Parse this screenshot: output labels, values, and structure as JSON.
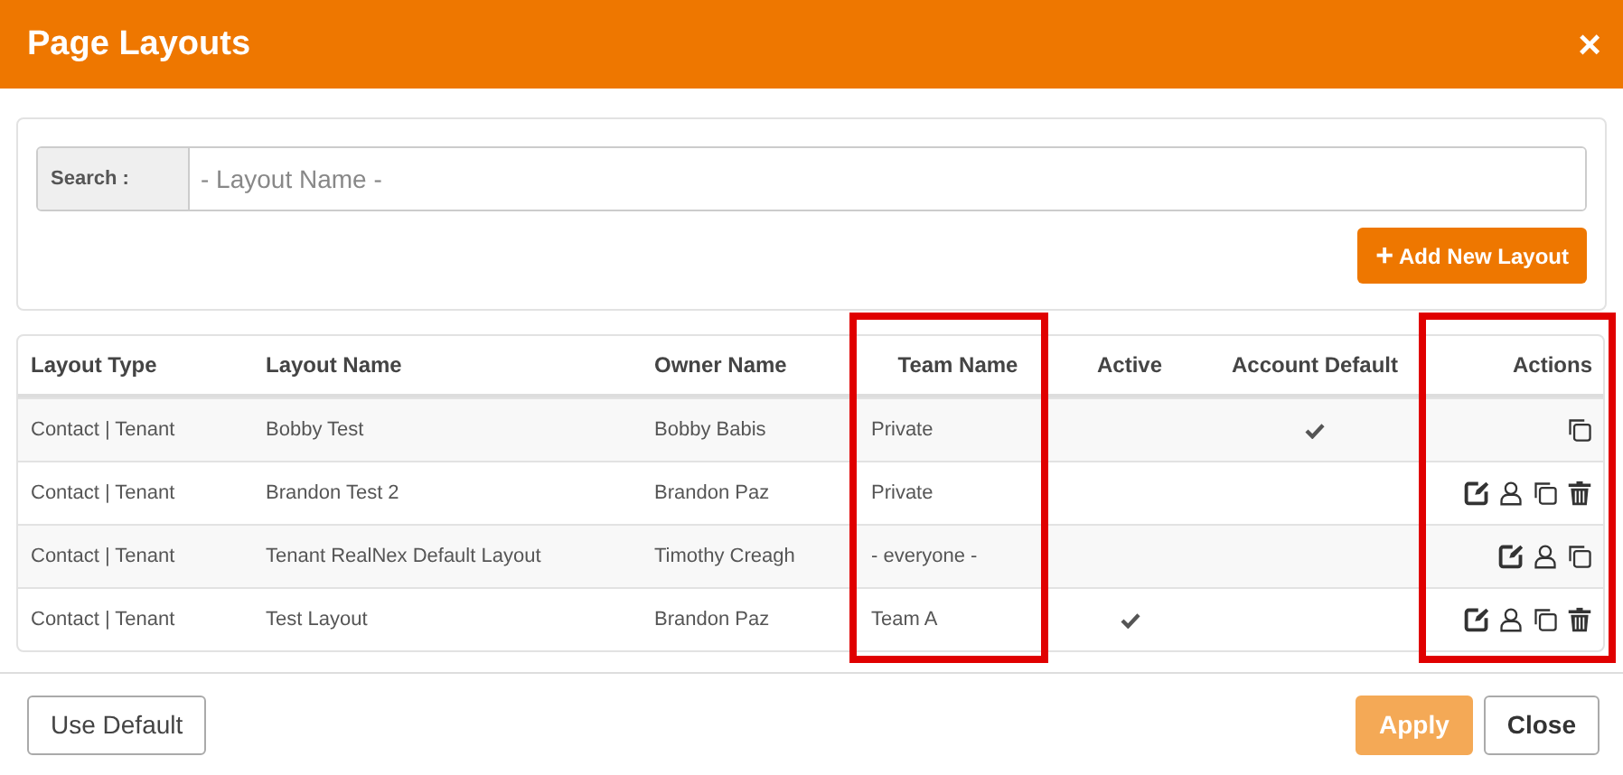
{
  "window": {
    "title": "Page Layouts",
    "close": "×"
  },
  "search": {
    "label": "Search :",
    "placeholder": "- Layout Name -"
  },
  "add_button": {
    "icon": "+",
    "label": "Add New Layout"
  },
  "table": {
    "columns": [
      {
        "label": "Layout Type",
        "highlighted": false
      },
      {
        "label": "Layout Name",
        "highlighted": false
      },
      {
        "label": "Owner Name",
        "highlighted": false
      },
      {
        "label": "Team Name",
        "highlighted": true
      },
      {
        "label": "Active",
        "highlighted": false
      },
      {
        "label": "Account Default",
        "highlighted": false
      },
      {
        "label": "Actions",
        "highlighted": true
      }
    ],
    "rows": [
      {
        "layout_type": "Contact | Tenant",
        "layout_name": "Bobby Test",
        "owner_name": "Bobby Babis",
        "team_name": "Private",
        "active": false,
        "account_default": true,
        "actions": [
          {
            "kind": "copy"
          }
        ]
      },
      {
        "layout_type": "Contact | Tenant",
        "layout_name": "Brandon Test 2",
        "owner_name": "Brandon Paz",
        "team_name": "Private",
        "active": false,
        "account_default": false,
        "actions": [
          {
            "kind": "edit"
          },
          {
            "kind": "share"
          },
          {
            "kind": "copy"
          },
          {
            "kind": "delete"
          }
        ]
      },
      {
        "layout_type": "Contact | Tenant",
        "layout_name": "Tenant RealNex Default Layout",
        "owner_name": "Timothy Creagh",
        "team_name": "- everyone -",
        "active": false,
        "account_default": false,
        "actions": [
          {
            "kind": "edit"
          },
          {
            "kind": "share"
          },
          {
            "kind": "copy"
          }
        ]
      },
      {
        "layout_type": "Contact | Tenant",
        "layout_name": "Test Layout",
        "owner_name": "Brandon Paz",
        "team_name": "Team A",
        "active": true,
        "account_default": false,
        "actions": [
          {
            "kind": "edit"
          },
          {
            "kind": "share"
          },
          {
            "kind": "copy"
          },
          {
            "kind": "delete"
          }
        ]
      }
    ]
  },
  "footer": {
    "use_default": "Use Default",
    "apply": {
      "label": "Apply",
      "disabled": true
    },
    "close": "Close"
  }
}
